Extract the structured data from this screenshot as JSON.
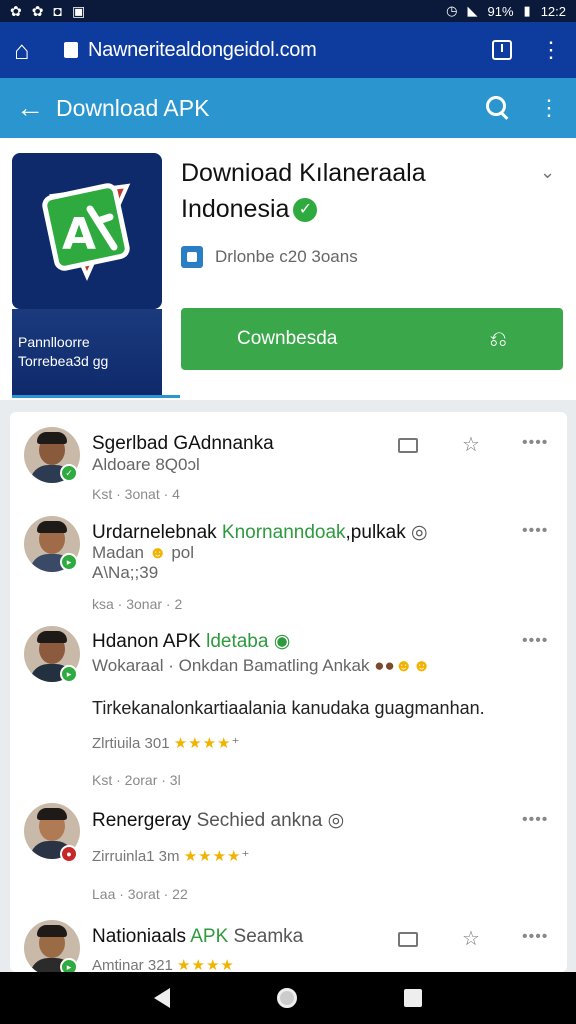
{
  "status_bar": {
    "left_icons": [
      "notification-icon",
      "notification-icon",
      "notification-icon",
      "notification-icon"
    ],
    "battery": "91%",
    "time": "12:2"
  },
  "browser": {
    "url": "Nawneritealdongeidol.com"
  },
  "app_bar": {
    "title": "Download APK"
  },
  "app": {
    "title_line1": "Downioad Kılaneraala",
    "title_line2": "Indonesia",
    "developer": "Drlonbe c20 3oans",
    "banner_line1": "Pannlloorre",
    "banner_line2": "Torrebea3d gg",
    "download_label": "Cownbesda",
    "colors": {
      "accent": "#2a95cf",
      "download": "#3aa84a",
      "verified": "#2eaa3f"
    }
  },
  "reviews": [
    {
      "name": "Sgerlbad GAdnnanka",
      "sub": "Aldoare 8Q0ɔl",
      "meta": "Kst · 3onat · 4"
    },
    {
      "name": "Urdarnelebnak",
      "name_green": "Knornanndoak",
      "name_rest": ",pulkak",
      "sub_green": "Madan",
      "sub_rest": "pol",
      "sub2": "A\\Na;;39",
      "meta": "ksa · 3onar · 2"
    },
    {
      "name": "Hdanon APK",
      "name_green": "ldetaba",
      "sub": "Wokaraal · Onkdan Bamatling Ankak",
      "body": "Tirkekanalonkartiaalania kanudaka guagmanhan.",
      "stars_label": "Zlrtiuila 301",
      "stars": "★★★★",
      "meta": "Kst · 2orar · 3l"
    },
    {
      "name": "Renergeray",
      "name_grey": "Sechied ankna",
      "stars_label": "Zirruinla1 3m",
      "stars": "★★★★",
      "meta": "Laa · 3orat · 22"
    },
    {
      "name": "Nationiaals",
      "name_green": "APK",
      "name_rest": "Seamka",
      "stars_label": "Amtinar 321",
      "stars": "★★★★"
    }
  ]
}
